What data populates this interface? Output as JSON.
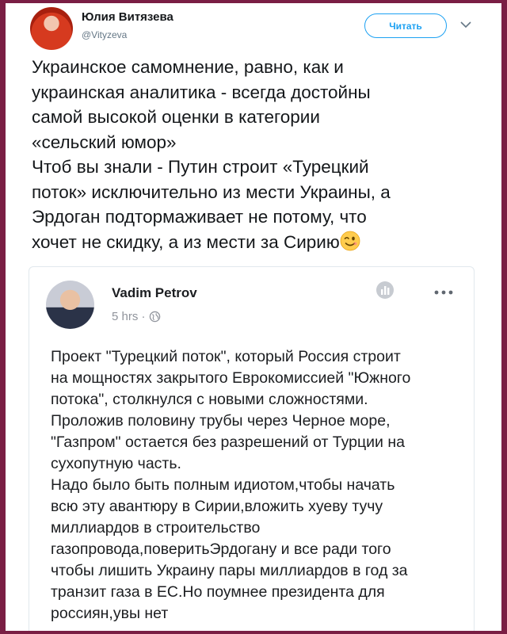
{
  "tweet": {
    "author_name": "Юлия Витязева",
    "author_handle": "@Vityzeva",
    "follow_label": "Читать",
    "text_lines": [
      "Украинское самомнение, равно, как и",
      "украинская аналитика - всегда достойны",
      "самой высокой оценки в категории",
      "«сельский юмор»",
      "Чтоб вы знали - Путин строит «Турецкий",
      "поток» исключительно из мести Украины, а",
      "Эрдоган подтормаживает не потому, что",
      "хочет не скидку, а из мести за Сирию"
    ],
    "emoji_icon": "winking-face-icon"
  },
  "embedded_post": {
    "author_name": "Vadim Petrov",
    "time": "5 hrs ·",
    "privacy_icon": "globe-icon",
    "text_lines": [
      "Проект \"Турецкий поток\", который Россия строит",
      "на мощностях закрытого Еврокомиссией \"Южного",
      "потока\", столкнулся с новыми сложностями.",
      "Проложив половину трубы через Черное море,",
      "\"Газпром\" остается без разрешений от Турции на",
      "сухопутную часть.",
      "Надо было быть полным идиотом,чтобы начать",
      "всю эту авантюру в Сирии,вложить хуеву тучу",
      "миллиардов в строительство",
      "газопровода,поверитьЭрдогану и все ради того",
      "чтобы лишить Украину пары миллиардов в год за",
      "транзит газа в ЕС.Но поумнее президента для",
      "россиян,увы нет"
    ]
  },
  "colors": {
    "frame": "#7a1e44",
    "twitter_blue": "#1da1f2",
    "secondary_text": "#657786"
  }
}
